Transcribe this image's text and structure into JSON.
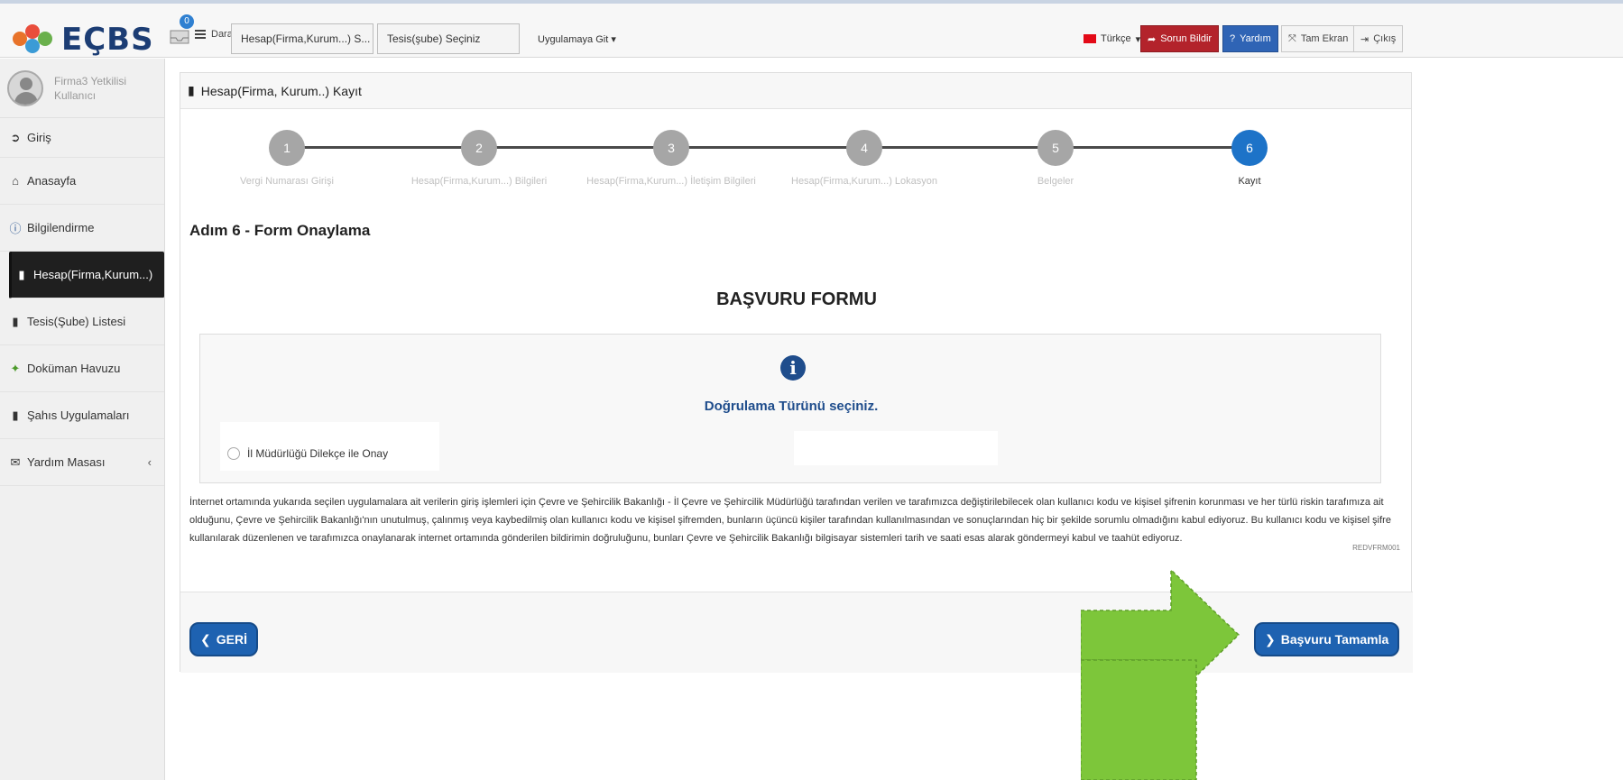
{
  "header": {
    "logo_text": "EÇBS",
    "notification_count": "0",
    "collapse_label": "Daralt",
    "account_select": "Hesap(Firma,Kurum...) S...",
    "branch_select": "Tesis(şube) Seçiniz",
    "app_select": "Uygulamaya Git",
    "language": "Türkçe",
    "report_issue": "Sorun Bildir",
    "help": "Yardım",
    "fullscreen": "Tam Ekran",
    "logout": "Çıkış"
  },
  "sidebar": {
    "user_name_line1": "Firma3 Yetkilisi",
    "user_name_line2": "Kullanıcı",
    "items": [
      {
        "label": "Giriş",
        "icon": "arrow-circle-icon"
      },
      {
        "label": "Anasayfa",
        "icon": "home-icon"
      },
      {
        "label": "Bilgilendirme",
        "icon": "info-icon"
      },
      {
        "label": "Hesap(Firma,Kurum...)",
        "icon": "building-icon"
      },
      {
        "label": "Tesis(Şube) Listesi",
        "icon": "building-icon"
      },
      {
        "label": "Doküman Havuzu",
        "icon": "users-icon"
      },
      {
        "label": "Şahıs Uygulamaları",
        "icon": "building-icon"
      },
      {
        "label": "Yardım Masası",
        "icon": "envelope-icon"
      }
    ]
  },
  "panel": {
    "title": "Hesap(Firma, Kurum..) Kayıt",
    "step_heading": "Adım 6 - Form Onaylama",
    "form_title": "BAŞVURU FORMU",
    "verify_prompt": "Doğrulama Türünü seçiniz.",
    "radio_option": "İl Müdürlüğü Dilekçe ile Onay",
    "disclaimer": "İnternet ortamında yukarıda seçilen uygulamalara ait verilerin giriş işlemleri için Çevre ve Şehircilik Bakanlığı - İl Çevre ve Şehircilik Müdürlüğü tarafından verilen ve tarafımızca değiştirilebilecek olan kullanıcı kodu ve kişisel şifrenin korunması ve her türlü riskin tarafımıza ait olduğunu, Çevre ve Şehircilik Bakanlığı'nın unutulmuş, çalınmış veya kaybedilmiş olan kullanıcı kodu ve kişisel şifremden, bunların üçüncü kişiler tarafından kullanılmasından ve sonuçlarından hiç bir şekilde sorumlu olmadığını kabul ediyoruz. Bu kullanıcı kodu ve kişisel şifre kullanılarak düzenlenen ve tarafımızca onaylanarak internet ortamında gönderilen bildirimin doğruluğunu, bunları Çevre ve Şehircilik Bakanlığı bilgisayar sistemleri tarih ve saati esas alarak göndermeyi kabul ve taahüt ediyoruz.",
    "ref_code": "REDVFRM001",
    "back_button": "GERİ",
    "submit_button": "Başvuru Tamamla"
  },
  "steps": [
    {
      "number": "1",
      "label": "Vergi Numarası Girişi",
      "active": false
    },
    {
      "number": "2",
      "label": "Hesap(Firma,Kurum...) Bilgileri",
      "active": false
    },
    {
      "number": "3",
      "label": "Hesap(Firma,Kurum...) İletişim Bilgileri",
      "active": false
    },
    {
      "number": "4",
      "label": "Hesap(Firma,Kurum...) Lokasyon",
      "active": false
    },
    {
      "number": "5",
      "label": "Belgeler",
      "active": false
    },
    {
      "number": "6",
      "label": "Kayıt",
      "active": true
    }
  ],
  "colors": {
    "brand_blue": "#1f4d8c",
    "active_step": "#1d73c8",
    "button_blue": "#1e62b1",
    "report_red": "#b3232b",
    "arrow_green": "#7dc63a"
  }
}
